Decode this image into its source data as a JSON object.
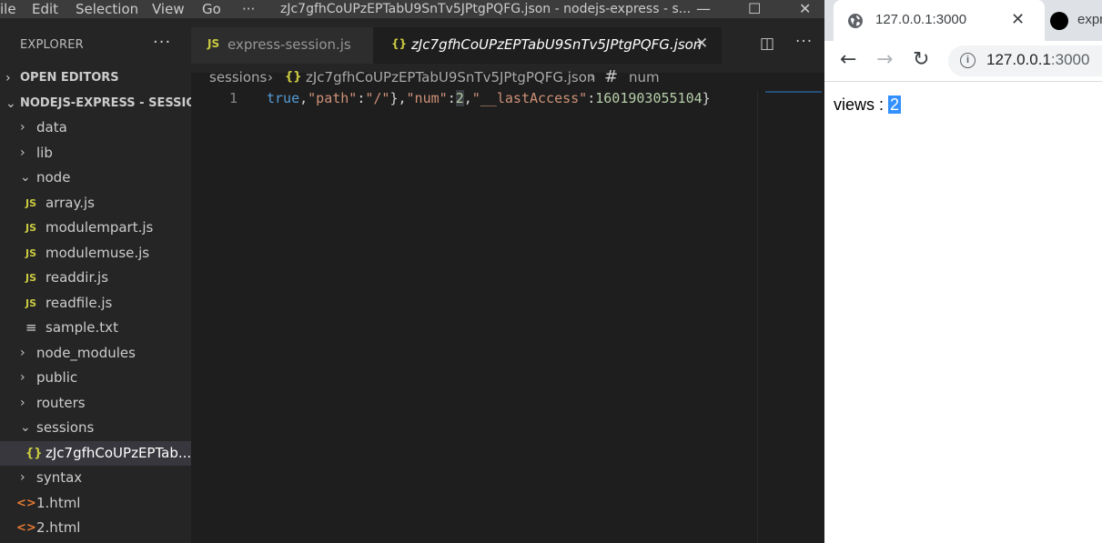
{
  "vscode": {
    "menu": [
      "ile",
      "Edit",
      "Selection",
      "View",
      "Go",
      "···"
    ],
    "window_title": "zJc7gfhCoUPzEPTabU9SnTv5JPtgPQFG.json - nodejs-express - s...",
    "sidebar": {
      "title": "EXPLORER",
      "more": "···",
      "open_editors": "OPEN EDITORS",
      "project": "NODEJS-EXPRESS - SESSIO...",
      "items": [
        {
          "label": "data",
          "kind": "folder",
          "expanded": false
        },
        {
          "label": "lib",
          "kind": "folder",
          "expanded": false
        },
        {
          "label": "node",
          "kind": "folder",
          "expanded": true
        },
        {
          "label": "array.js",
          "kind": "js"
        },
        {
          "label": "modulempart.js",
          "kind": "js"
        },
        {
          "label": "modulemuse.js",
          "kind": "js"
        },
        {
          "label": "readdir.js",
          "kind": "js"
        },
        {
          "label": "readfile.js",
          "kind": "js"
        },
        {
          "label": "sample.txt",
          "kind": "txt"
        },
        {
          "label": "node_modules",
          "kind": "folder",
          "expanded": false
        },
        {
          "label": "public",
          "kind": "folder",
          "expanded": false
        },
        {
          "label": "routers",
          "kind": "folder",
          "expanded": false
        },
        {
          "label": "sessions",
          "kind": "folder",
          "expanded": true
        },
        {
          "label": "zJc7gfhCoUPzEPTab...",
          "kind": "json",
          "selected": true
        },
        {
          "label": "syntax",
          "kind": "folder",
          "expanded": false
        },
        {
          "label": "1.html",
          "kind": "html"
        },
        {
          "label": "2.html",
          "kind": "html"
        }
      ],
      "icon_glyphs": {
        "js": "JS",
        "json": "{}",
        "txt": "≡",
        "html": "<>"
      }
    },
    "tabs": [
      {
        "label": "express-session.js",
        "icon": "JS",
        "active": false
      },
      {
        "label": "zJc7gfhCoUPzEPTabU9SnTv5JPtgPQFG.json",
        "icon": "{}",
        "active": true,
        "close": "✕"
      }
    ],
    "breadcrumb": {
      "folder": "sessions",
      "file": "zJc7gfhCoUPzEPTabU9SnTv5JPtgPQFG.json",
      "symbol": "num",
      "separator": "›"
    },
    "editor": {
      "line_number": "1",
      "code_tokens": [
        {
          "t": "true",
          "c": "k"
        },
        {
          "t": ",",
          "c": "p"
        },
        {
          "t": "\"path\"",
          "c": "s"
        },
        {
          "t": ":",
          "c": "p"
        },
        {
          "t": "\"/\"",
          "c": "s"
        },
        {
          "t": "},",
          "c": "p"
        },
        {
          "t": "\"num\"",
          "c": "s"
        },
        {
          "t": ":",
          "c": "p"
        },
        {
          "t": "2",
          "c": "n cursor-num"
        },
        {
          "t": ",",
          "c": "p"
        },
        {
          "t": "\"__lastAccess\"",
          "c": "s"
        },
        {
          "t": ":",
          "c": "p"
        },
        {
          "t": "1601903055104",
          "c": "n"
        },
        {
          "t": "}",
          "c": "p"
        }
      ]
    },
    "colors": {
      "titlebar": "#3c3c3c",
      "sidebar": "#252526",
      "editor": "#1e1e1e",
      "js_icon": "#cbcb41",
      "html_icon": "#e37933"
    }
  },
  "browser": {
    "tabs": [
      {
        "title": "127.0.0.1:3000",
        "icon": "globe-icon",
        "close": "✕"
      },
      {
        "title": "expr",
        "icon": "circle-icon"
      }
    ],
    "url_host": "127.0.0.1",
    "url_port": ":3000",
    "page": {
      "label": "views : ",
      "value": "2"
    },
    "colors": {
      "selection": "#3390ff",
      "tabstrip": "#dee1e6"
    }
  }
}
